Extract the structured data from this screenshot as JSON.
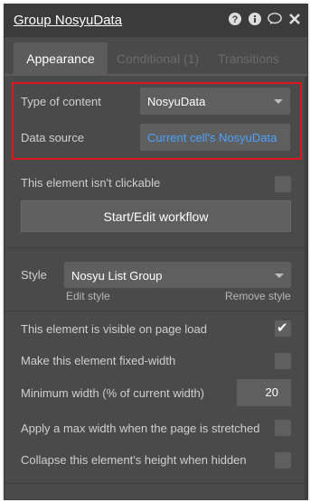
{
  "header": {
    "title": "Group NosyuData",
    "icons": [
      "help-circle-icon",
      "info-icon",
      "comment-icon",
      "close-icon"
    ]
  },
  "tabs": [
    {
      "label": "Appearance",
      "active": true
    },
    {
      "label": "Conditional (1)",
      "active": false
    },
    {
      "label": "Transitions",
      "active": false
    }
  ],
  "content": {
    "type_of_content_label": "Type of content",
    "type_of_content_value": "NosyuData",
    "data_source_label": "Data source",
    "data_source_value": "Current cell's NosyuData",
    "not_clickable_label": "This element isn't clickable",
    "not_clickable_checked": false,
    "workflow_button": "Start/Edit workflow",
    "style_label": "Style",
    "style_value": "Nosyu List Group",
    "edit_style": "Edit style",
    "remove_style": "Remove style",
    "visible_label": "This element is visible on page load",
    "visible_checked": true,
    "fixed_width_label": "Make this element fixed-width",
    "fixed_width_checked": false,
    "min_width_label": "Minimum width (% of current width)",
    "min_width_value": "20",
    "max_width_label": "Apply a max width when the page is stretched",
    "max_width_checked": false,
    "collapse_label": "Collapse this element's height when hidden",
    "collapse_checked": false
  },
  "colors": {
    "panel_bg": "#4a4a4a",
    "header_bg": "#3b3b3b",
    "input_bg": "#5f5f5f",
    "accent_blue": "#4aa3ff",
    "highlight_red": "#e2161f"
  }
}
